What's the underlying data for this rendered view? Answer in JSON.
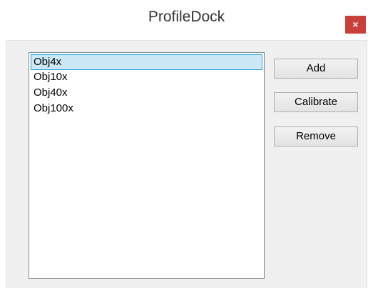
{
  "window": {
    "title": "ProfileDock",
    "close_glyph": "×"
  },
  "profile_list": {
    "items": [
      {
        "label": "Obj4x",
        "selected": true
      },
      {
        "label": "Obj10x",
        "selected": false
      },
      {
        "label": "Obj40x",
        "selected": false
      },
      {
        "label": "Obj100x",
        "selected": false
      }
    ]
  },
  "buttons": {
    "add_label": "Add",
    "calibrate_label": "Calibrate",
    "remove_label": "Remove"
  },
  "colors": {
    "close_button": "#c9403a",
    "selection_fill": "#cce8f7",
    "selection_border": "#26a0da"
  }
}
